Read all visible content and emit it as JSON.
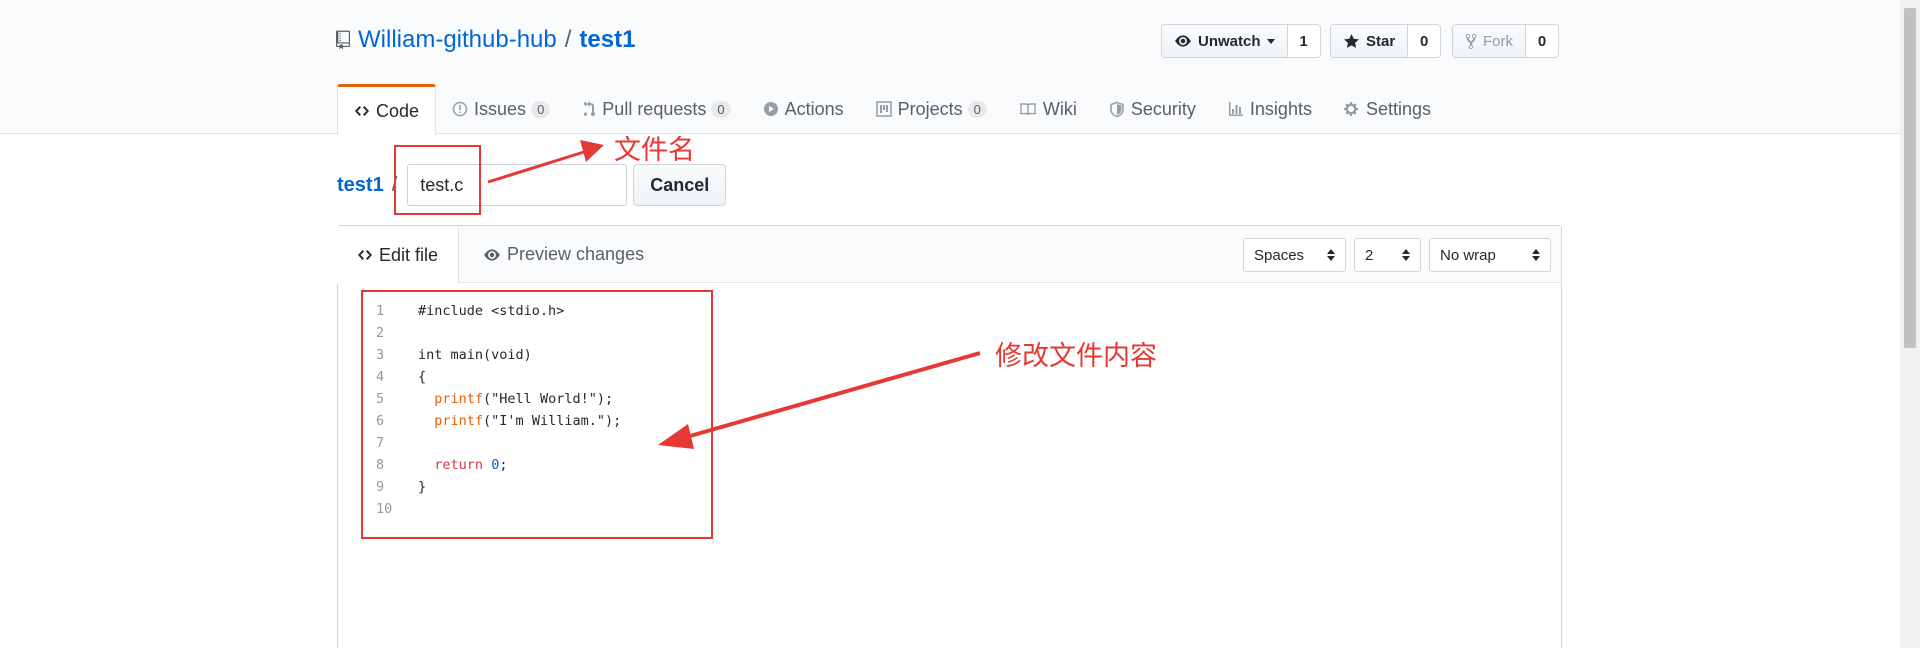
{
  "repo": {
    "owner": "William-github-hub",
    "separator": "/",
    "name": "test1"
  },
  "social": {
    "watch": {
      "label": "Unwatch",
      "count": "1"
    },
    "star": {
      "label": "Star",
      "count": "0"
    },
    "fork": {
      "label": "Fork",
      "count": "0"
    }
  },
  "tabs": [
    {
      "label": "Code",
      "icon": "code-icon"
    },
    {
      "label": "Issues",
      "count": "0",
      "icon": "issue-icon"
    },
    {
      "label": "Pull requests",
      "count": "0",
      "icon": "pull-request-icon"
    },
    {
      "label": "Actions",
      "icon": "play-icon"
    },
    {
      "label": "Projects",
      "count": "0",
      "icon": "project-icon"
    },
    {
      "label": "Wiki",
      "icon": "book-icon"
    },
    {
      "label": "Security",
      "icon": "shield-icon"
    },
    {
      "label": "Insights",
      "icon": "graph-icon"
    },
    {
      "label": "Settings",
      "icon": "gear-icon"
    }
  ],
  "breadcrumb": {
    "root": "test1",
    "separator": "/",
    "filename_value": "test.c",
    "cancel_label": "Cancel"
  },
  "editor": {
    "tab_edit": "Edit file",
    "tab_preview": "Preview changes",
    "indent_mode": "Spaces",
    "indent_size": "2",
    "wrap_mode": "No wrap",
    "line_numbers": [
      "1",
      "2",
      "3",
      "4",
      "5",
      "6",
      "7",
      "8",
      "9",
      "10"
    ],
    "lines": {
      "l1": "#include <stdio.h>",
      "l3": "int main(void)",
      "l4": "{",
      "l5_fn": "printf",
      "l5_rest": "(\"Hell World!\");",
      "l6_fn": "printf",
      "l6_rest": "(\"I'm William.\");",
      "l8_kw": "return",
      "l8_num": "0",
      "l8_end": ";",
      "l9": "}"
    }
  },
  "annotations": {
    "filename_note": "文件名",
    "content_note": "修改文件内容",
    "color": "#e53935"
  },
  "colors": {
    "link": "#0366d6",
    "tab_accent": "#e36209"
  }
}
